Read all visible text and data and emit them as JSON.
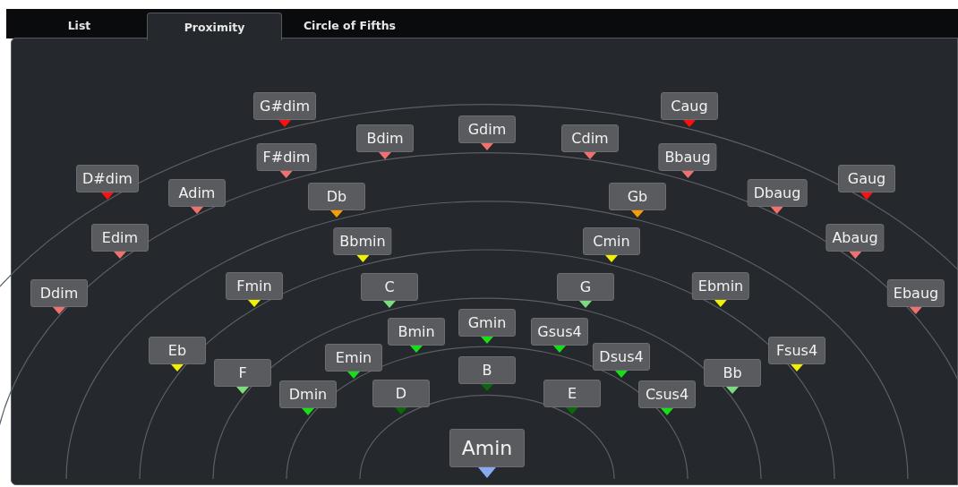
{
  "tabs": [
    {
      "label": "List",
      "selected": false
    },
    {
      "label": "Proximity",
      "selected": true
    },
    {
      "label": "Circle of Fifths",
      "selected": false
    }
  ],
  "chords": [
    {
      "label": "G#dim",
      "color": "#ff1010",
      "kind": "chord"
    },
    {
      "label": "Caug",
      "color": "#ff1010",
      "kind": "chord"
    },
    {
      "label": "Bdim",
      "color": "#f07070",
      "kind": "chord"
    },
    {
      "label": "Gdim",
      "color": "#f07070",
      "kind": "chord"
    },
    {
      "label": "Cdim",
      "color": "#f07070",
      "kind": "chord"
    },
    {
      "label": "F#dim",
      "color": "#f07070",
      "kind": "chord"
    },
    {
      "label": "Bbaug",
      "color": "#f07070",
      "kind": "chord"
    },
    {
      "label": "D#dim",
      "color": "#ff1010",
      "kind": "chord"
    },
    {
      "label": "Adim",
      "color": "#f07070",
      "kind": "chord"
    },
    {
      "label": "Db",
      "color": "#f5a000",
      "kind": "chord"
    },
    {
      "label": "Gb",
      "color": "#f5a000",
      "kind": "chord"
    },
    {
      "label": "Dbaug",
      "color": "#f07070",
      "kind": "chord"
    },
    {
      "label": "Gaug",
      "color": "#ff1010",
      "kind": "chord"
    },
    {
      "label": "Edim",
      "color": "#f07070",
      "kind": "chord"
    },
    {
      "label": "Bbmin",
      "color": "#f0f000",
      "kind": "chord"
    },
    {
      "label": "Cmin",
      "color": "#f0f000",
      "kind": "chord"
    },
    {
      "label": "Abaug",
      "color": "#f07070",
      "kind": "chord"
    },
    {
      "label": "Ddim",
      "color": "#f07070",
      "kind": "chord"
    },
    {
      "label": "Fmin",
      "color": "#f0f000",
      "kind": "chord"
    },
    {
      "label": "C",
      "color": "#7ddc7d",
      "kind": "chord"
    },
    {
      "label": "G",
      "color": "#7ddc7d",
      "kind": "chord"
    },
    {
      "label": "Ebmin",
      "color": "#f0f000",
      "kind": "chord"
    },
    {
      "label": "Ebaug",
      "color": "#f07070",
      "kind": "chord"
    },
    {
      "label": "Eb",
      "color": "#f0f000",
      "kind": "chord"
    },
    {
      "label": "F",
      "color": "#7ddc7d",
      "kind": "chord"
    },
    {
      "label": "Dmin",
      "color": "#18dd18",
      "kind": "chord"
    },
    {
      "label": "Emin",
      "color": "#18dd18",
      "kind": "chord"
    },
    {
      "label": "Bmin",
      "color": "#18dd18",
      "kind": "chord"
    },
    {
      "label": "Gmin",
      "color": "#18dd18",
      "kind": "chord"
    },
    {
      "label": "Gsus4",
      "color": "#18dd18",
      "kind": "chord"
    },
    {
      "label": "Dsus4",
      "color": "#18dd18",
      "kind": "chord"
    },
    {
      "label": "B",
      "color": "#0a6a0a",
      "kind": "chord"
    },
    {
      "label": "D",
      "color": "#0a6a0a",
      "kind": "chord"
    },
    {
      "label": "E",
      "color": "#0a6a0a",
      "kind": "chord"
    },
    {
      "label": "Csus4",
      "color": "#18dd18",
      "kind": "chord"
    },
    {
      "label": "Bb",
      "color": "#7ddc7d",
      "kind": "chord"
    },
    {
      "label": "Fsus4",
      "color": "#f0f000",
      "kind": "chord"
    },
    {
      "label": "Amin",
      "color": "#88aaee",
      "kind": "root"
    }
  ]
}
